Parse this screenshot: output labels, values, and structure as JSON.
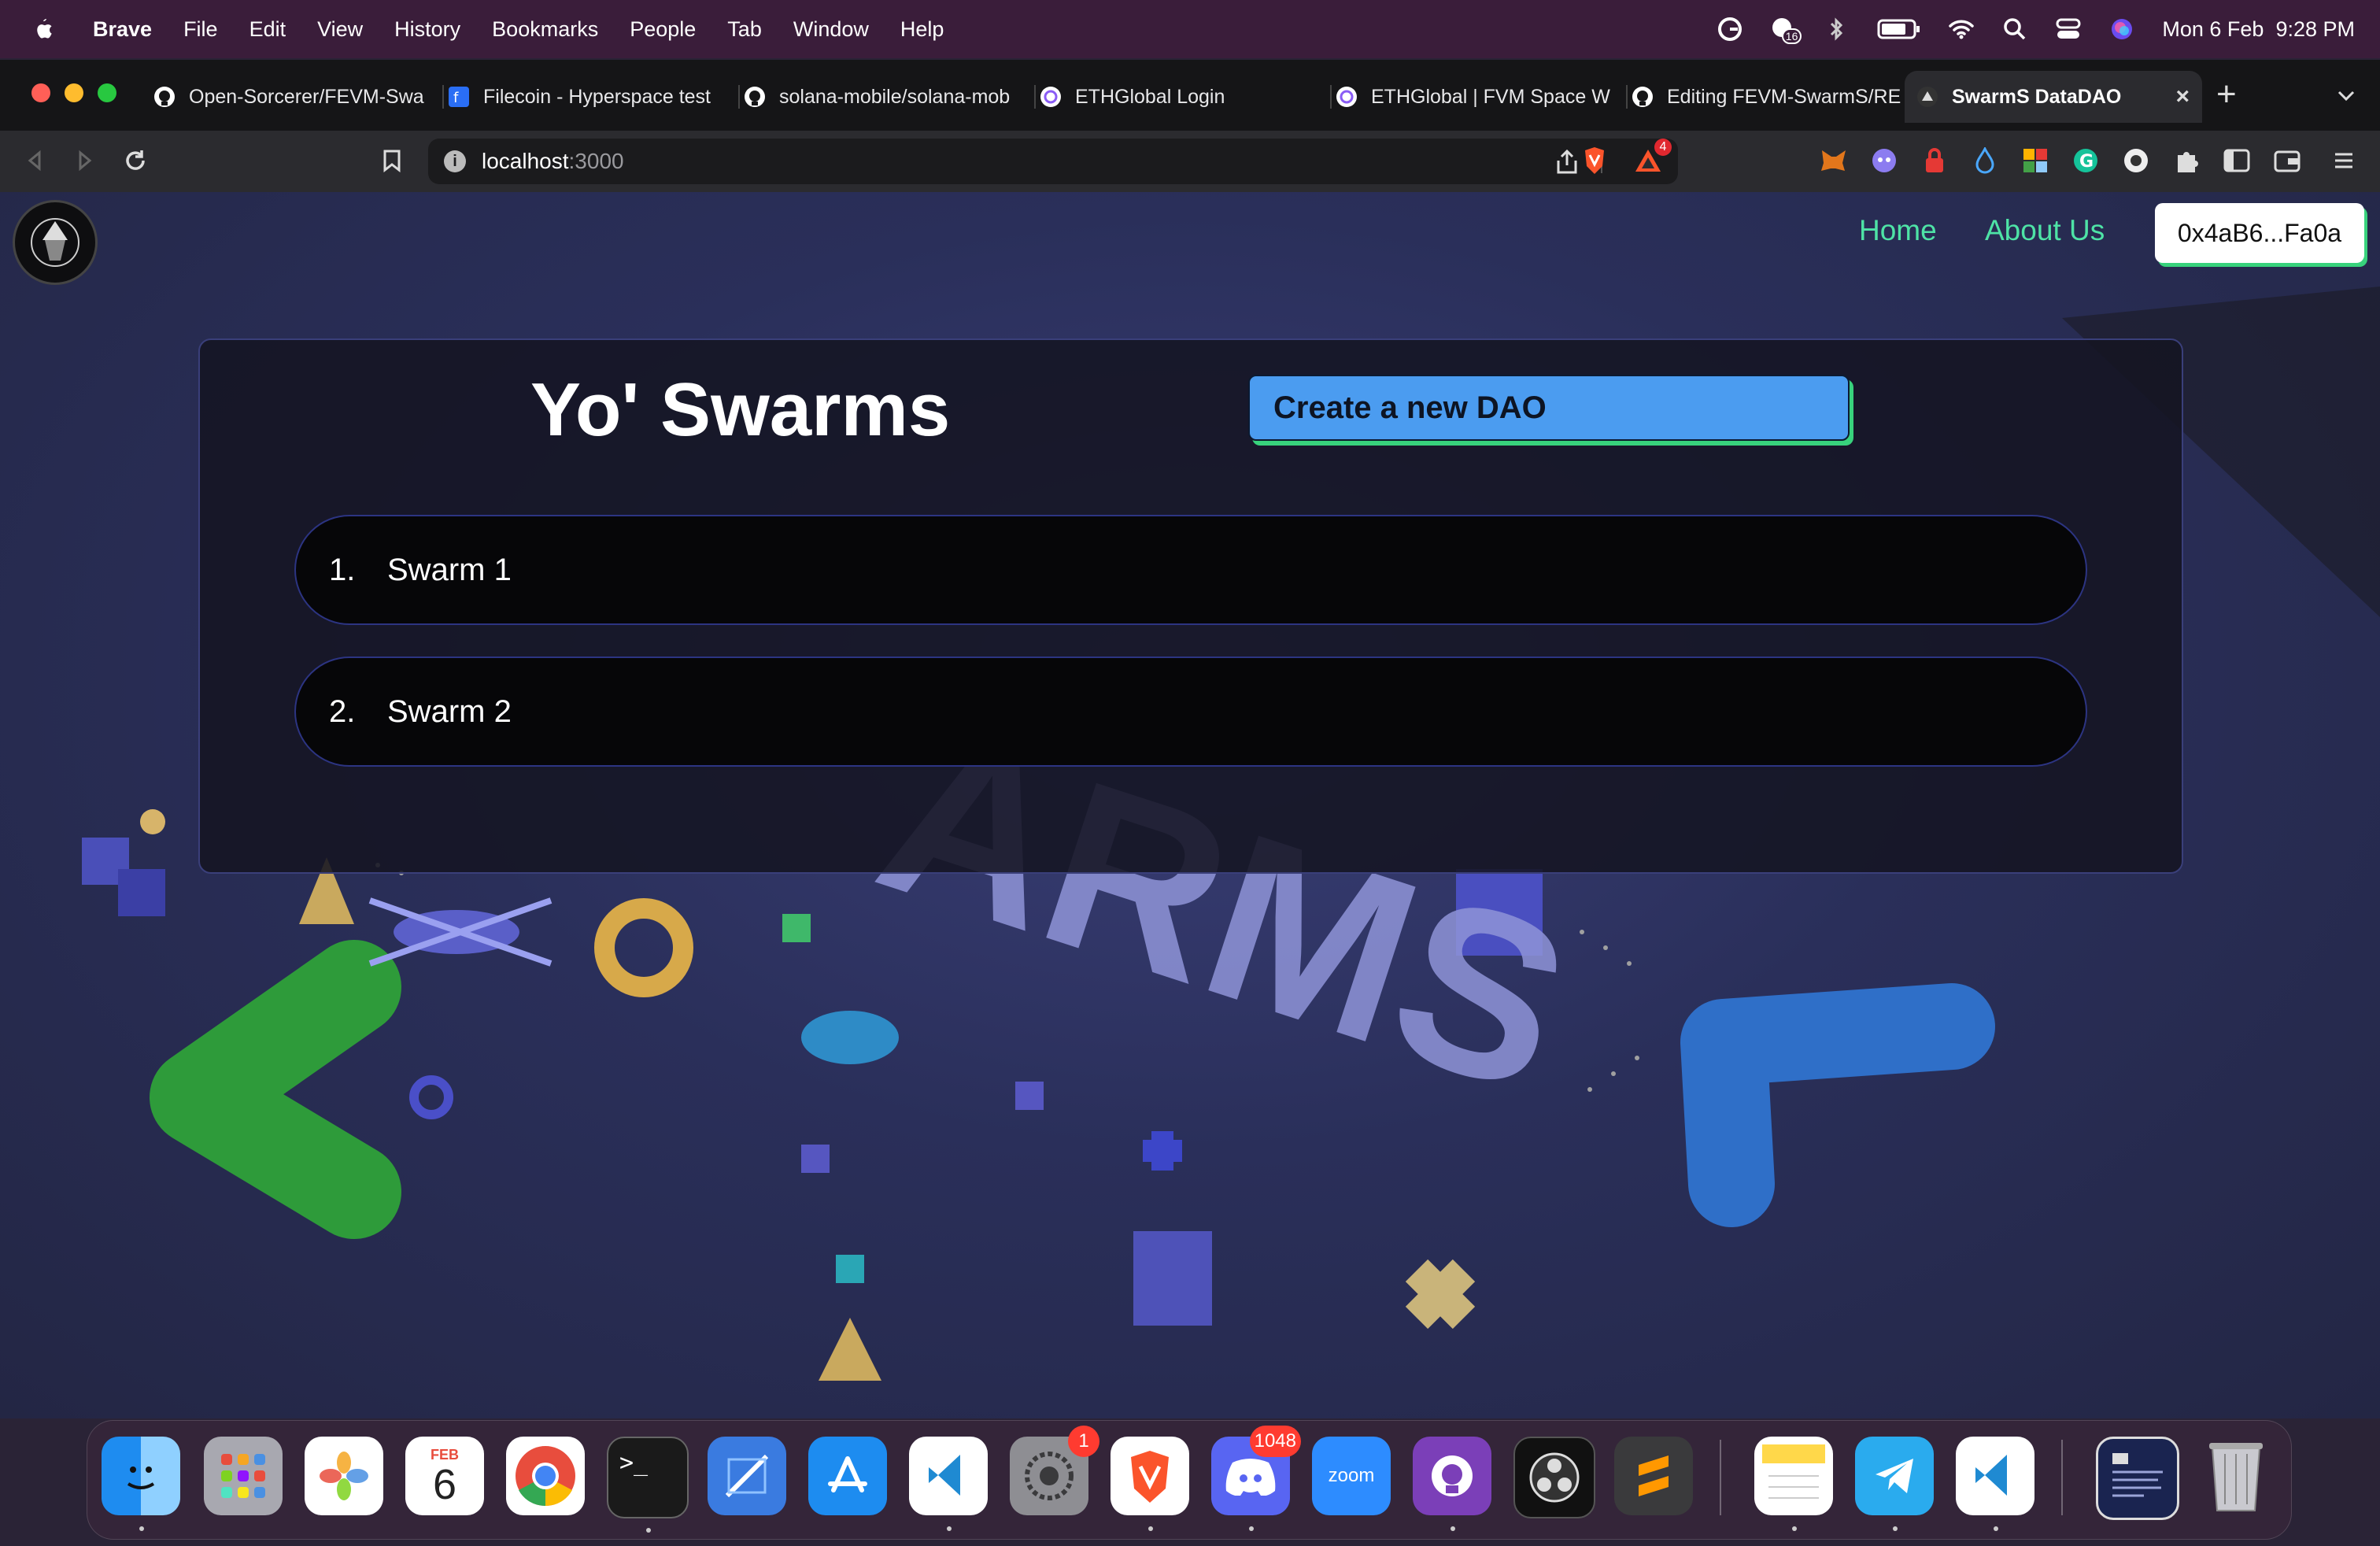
{
  "menubar": {
    "app_name": "Brave",
    "items": [
      "File",
      "Edit",
      "View",
      "History",
      "Bookmarks",
      "People",
      "Tab",
      "Window",
      "Help"
    ],
    "clock": "Mon 6 Feb  9:28 PM",
    "status_badge": "16"
  },
  "tabs": [
    {
      "label": "Open-Sorcerer/FEVM-Swa",
      "icon": "github-icon"
    },
    {
      "label": "Filecoin - Hyperspace test",
      "icon": "filecoin-icon"
    },
    {
      "label": "solana-mobile/solana-mob",
      "icon": "github-icon"
    },
    {
      "label": "ETHGlobal Login",
      "icon": "ethglobal-icon"
    },
    {
      "label": "ETHGlobal | FVM Space W",
      "icon": "ethglobal-icon"
    },
    {
      "label": "Editing FEVM-SwarmS/RE",
      "icon": "github-icon"
    },
    {
      "label": "SwarmS DataDAO",
      "icon": "swarms-icon"
    }
  ],
  "address_bar": {
    "host": "localhost",
    "port": ":3000",
    "alert_count": "4"
  },
  "site": {
    "nav": {
      "home": "Home",
      "about": "About Us",
      "wallet": "0x4aB6...Fa0a"
    },
    "title": "Yo' Swarms",
    "create_button": "Create a new DAO",
    "swarms": [
      {
        "num": "1.",
        "name": "Swarm 1"
      },
      {
        "num": "2.",
        "name": "Swarm 2"
      }
    ],
    "background_text": "ARMS"
  },
  "dock": {
    "calendar_month": "FEB",
    "calendar_day": "6",
    "settings_badge": "1",
    "discord_badge": "1048",
    "zoom_label": "zoom"
  }
}
